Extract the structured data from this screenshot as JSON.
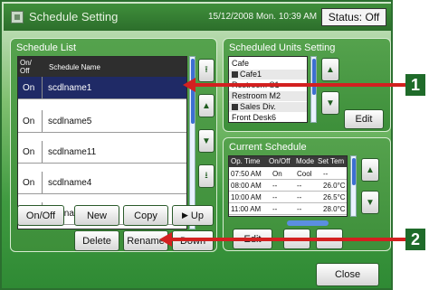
{
  "window": {
    "title": "Schedule Setting",
    "datetime": "15/12/2008 Mon. 10:39 AM",
    "status": "Status: Off"
  },
  "schedule_list": {
    "title": "Schedule List",
    "header_onoff": "On/ Off",
    "header_name": "Schedule Name",
    "rows": [
      {
        "onoff": "On",
        "name": "scdlname1",
        "selected": true
      },
      {
        "onoff": "On",
        "name": "scdlname5"
      },
      {
        "onoff": "On",
        "name": "scdlname11"
      },
      {
        "onoff": "On",
        "name": "scdlname4"
      },
      {
        "onoff": "On",
        "name": "scdlname20"
      }
    ],
    "buttons": {
      "onoff": "On/Off",
      "new": "New",
      "copy": "Copy",
      "up": "Up",
      "delete": "Delete",
      "rename": "Rename",
      "down": "Down"
    }
  },
  "scheduled_units": {
    "title": "Scheduled Units Setting",
    "items": [
      "Cafe",
      "Cafe1",
      "Restroom S1",
      "Restroom M2",
      "Sales Div.",
      "Front Desk6"
    ],
    "edit": "Edit"
  },
  "current_schedule": {
    "title": "Current Schedule",
    "headers": [
      "Op. Time",
      "On/Off",
      "Mode",
      "Set Tem"
    ],
    "rows": [
      [
        "07:50 AM",
        "On",
        "Cool",
        "--"
      ],
      [
        "08:00 AM",
        "--",
        "--",
        "26.0°C"
      ],
      [
        "10:00 AM",
        "--",
        "--",
        "26.5°C"
      ],
      [
        "11:00 AM",
        "--",
        "--",
        "28.0°C"
      ]
    ],
    "edit": "Edit"
  },
  "close": "Close",
  "callouts": [
    "1",
    "2"
  ]
}
